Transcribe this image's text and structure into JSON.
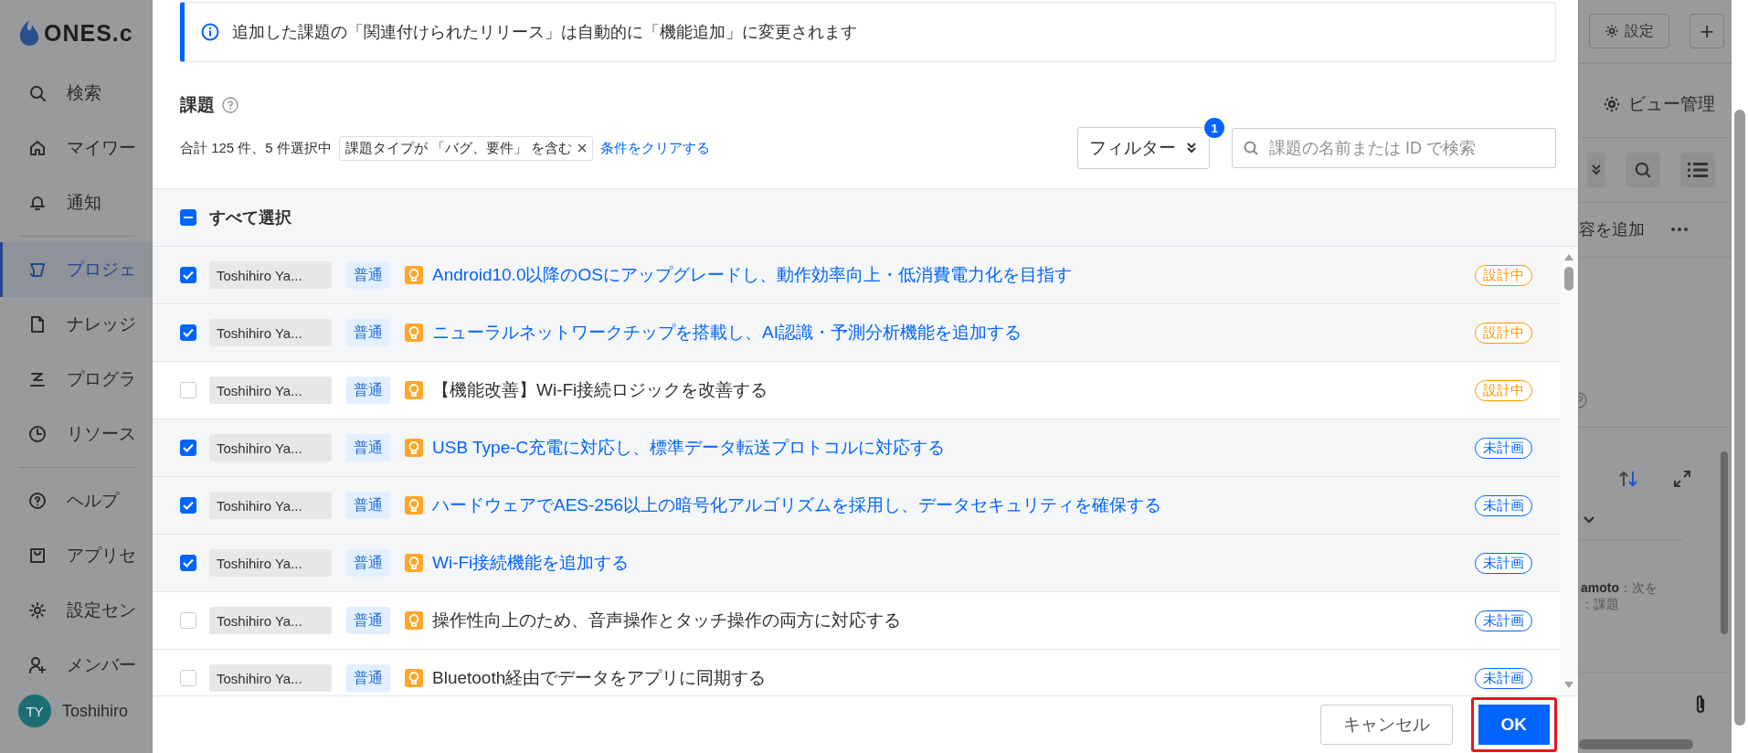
{
  "sidebar": {
    "logo": "ONES.c",
    "groups": [
      [
        {
          "label": "検索",
          "selected": false
        },
        {
          "label": "マイワー",
          "selected": false
        },
        {
          "label": "通知",
          "selected": false
        }
      ],
      [
        {
          "label": "プロジェ",
          "selected": true
        },
        {
          "label": "ナレッジ",
          "selected": false
        },
        {
          "label": "プログラ",
          "selected": false
        },
        {
          "label": "リソース",
          "selected": false
        }
      ],
      [
        {
          "label": "ヘルプ",
          "selected": false
        },
        {
          "label": "アプリセ",
          "selected": false
        },
        {
          "label": "設定セン",
          "selected": false
        },
        {
          "label": "メンバー",
          "selected": false
        }
      ]
    ],
    "user": {
      "initials": "TY",
      "name": "Toshihiro"
    }
  },
  "dialog": {
    "notice": "追加した課題の「関連付けられたリリース」は自動的に「機能追加」に変更されます",
    "section_title": "課題",
    "summary": "合計 125 件、5 件選択中",
    "filter_tag": "課題タイプが 「バグ、要件」 を含む",
    "clear_link": "条件をクリアする",
    "filter_button": "フィルター",
    "filter_count": "1",
    "search": {
      "placeholder": "課題の名前または ID で検索"
    },
    "select_all": {
      "label": "すべて選択",
      "indeterminate": true
    },
    "rows": [
      {
        "checked": true,
        "assignee": "Toshihiro Ya...",
        "priority": "普通",
        "title": "Android10.0以降のOSにアップグレードし、動作効率向上・低消費電力化を目指す",
        "status": "設計中",
        "color": "#ff9800"
      },
      {
        "checked": true,
        "assignee": "Toshihiro Ya...",
        "priority": "普通",
        "title": "ニューラルネットワークチップを搭載し、AI認識・予測分析機能を追加する",
        "status": "設計中",
        "color": "#ff9800"
      },
      {
        "checked": false,
        "assignee": "Toshihiro Ya...",
        "priority": "普通",
        "title": "【機能改善】Wi-Fi接続ロジックを改善する",
        "status": "設計中",
        "color": "#ff9800"
      },
      {
        "checked": true,
        "assignee": "Toshihiro Ya...",
        "priority": "普通",
        "title": "USB Type-C充電に対応し、標準データ転送プロトコルに対応する",
        "status": "未計画",
        "color": "#0064ff"
      },
      {
        "checked": true,
        "assignee": "Toshihiro Ya...",
        "priority": "普通",
        "title": "ハードウェアでAES-256以上の暗号化アルゴリズムを採用し、データセキュリティを確保する",
        "status": "未計画",
        "color": "#0064ff"
      },
      {
        "checked": true,
        "assignee": "Toshihiro Ya...",
        "priority": "普通",
        "title": "Wi-Fi接続機能を追加する",
        "status": "未計画",
        "color": "#0064ff"
      },
      {
        "checked": false,
        "assignee": "Toshihiro Ya...",
        "priority": "普通",
        "title": "操作性向上のため、音声操作とタッチ操作の両方に対応する",
        "status": "未計画",
        "color": "#0064ff"
      },
      {
        "checked": false,
        "assignee": "Toshihiro Ya...",
        "priority": "普通",
        "title": "Bluetooth経由でデータをアプリに同期する",
        "status": "未計画",
        "color": "#0064ff"
      }
    ],
    "buttons": [
      {
        "label": "キャンセル",
        "kind": "secondary",
        "highlighted": false
      },
      {
        "label": "OK",
        "kind": "primary",
        "highlighted": true
      }
    ]
  },
  "background": {
    "settings_button": "設定",
    "add_button": "+",
    "view_manage": "ビュー管理",
    "add_content": "容を追加",
    "comment_author": "amoto",
    "comment_text": "：次を",
    "comment_line2": "：課題"
  }
}
